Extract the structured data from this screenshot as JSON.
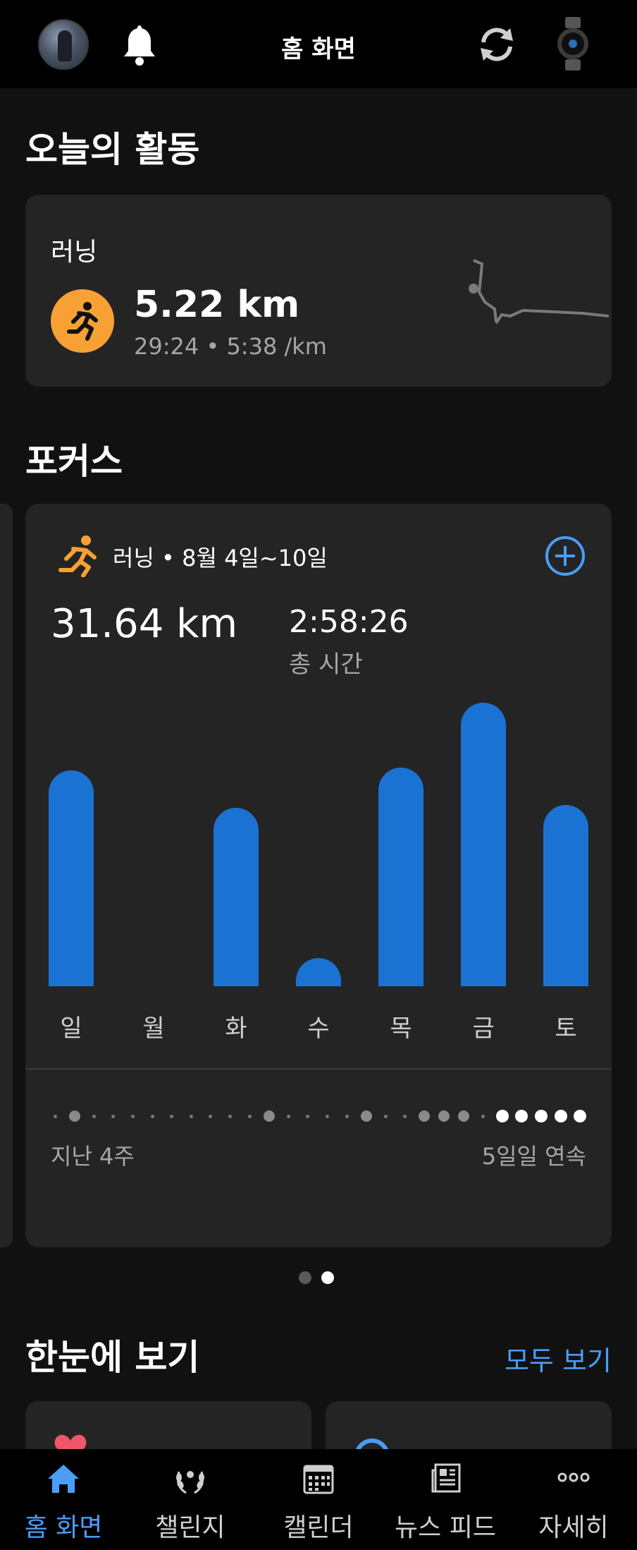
{
  "header": {
    "title": "홈 화면",
    "icons": [
      "profile-avatar",
      "bell-icon",
      "sync-icon",
      "watch-icon"
    ]
  },
  "today": {
    "section_title": "오늘의 활동",
    "activity_type": "러닝",
    "distance": "5.22 km",
    "details": "29:24 • 5:38 /km",
    "accent_color": "#f7a134"
  },
  "focus": {
    "section_title": "포커스",
    "header": "러닝 • 8월 4일~10일",
    "total_distance": "31.64 km",
    "total_time": "2:58:26",
    "total_time_label": "총 시간",
    "streak_left": "지난 4주",
    "streak_right": "5일일 연속",
    "bar_color": "#1a73d3"
  },
  "chart_data": {
    "type": "bar",
    "categories": [
      "일",
      "월",
      "화",
      "수",
      "목",
      "금",
      "토"
    ],
    "values": [
      0.76,
      0,
      0.63,
      0.1,
      0.77,
      1.0,
      0.64
    ],
    "ylim": [
      0,
      1
    ]
  },
  "streak": {
    "dots": [
      0,
      1,
      0,
      0,
      0,
      0,
      0,
      0,
      0,
      0,
      0,
      1,
      0,
      0,
      0,
      0,
      1,
      0,
      0,
      1,
      1,
      1,
      0,
      2,
      2,
      2,
      2,
      2
    ]
  },
  "pager": {
    "count": 2,
    "active": 1
  },
  "glance": {
    "section_title": "한눈에 보기",
    "see_all": "모두 보기"
  },
  "nav": {
    "items": [
      {
        "label": "홈 화면",
        "icon": "home-icon",
        "active": true
      },
      {
        "label": "챌린지",
        "icon": "laurel-icon",
        "active": false
      },
      {
        "label": "캘린더",
        "icon": "calendar-icon",
        "active": false
      },
      {
        "label": "뉴스 피드",
        "icon": "news-icon",
        "active": false
      },
      {
        "label": "자세히",
        "icon": "more-icon",
        "active": false
      }
    ]
  }
}
